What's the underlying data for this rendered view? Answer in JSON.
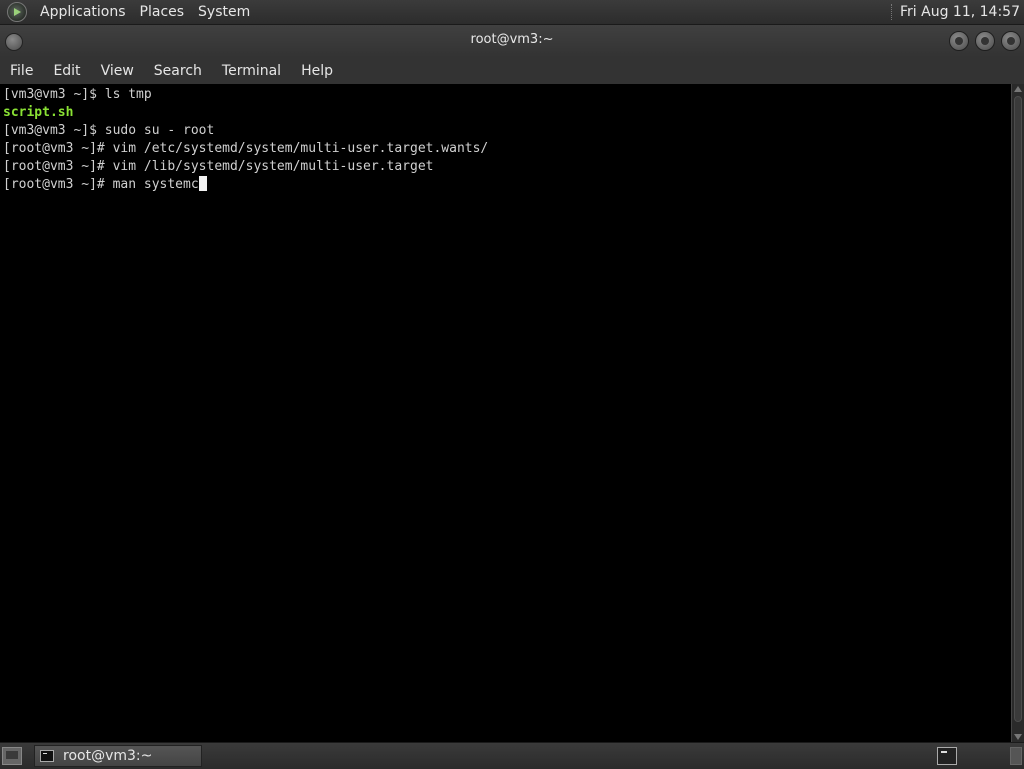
{
  "top_panel": {
    "menus": [
      "Applications",
      "Places",
      "System"
    ],
    "clock": "Fri Aug 11, 14:57"
  },
  "window": {
    "title": "root@vm3:~",
    "menus": [
      "File",
      "Edit",
      "View",
      "Search",
      "Terminal",
      "Help"
    ]
  },
  "terminal": {
    "lines": [
      "[vm3@vm3 ~]$ ls tmp",
      "script.sh",
      "[vm3@vm3 ~]$ sudo su - root",
      "[root@vm3 ~]# vim /etc/systemd/system/multi-user.target.wants/",
      "[root@vm3 ~]# vim /lib/systemd/system/multi-user.target",
      "[root@vm3 ~]# man systemc"
    ],
    "colors": {
      "text": "#d0d0d0",
      "executable": "#8ae234",
      "background": "#000000"
    }
  },
  "taskbar": {
    "task_label": "root@vm3:~"
  },
  "icons": {
    "os_logo": "distro-logo-icon",
    "window_menu": "window-menu-icon",
    "minimize": "minimize-icon",
    "maximize": "maximize-icon",
    "close": "close-icon",
    "show_desktop": "show-desktop-icon",
    "task_terminal": "terminal-icon",
    "tray_terminal": "terminal-icon"
  }
}
